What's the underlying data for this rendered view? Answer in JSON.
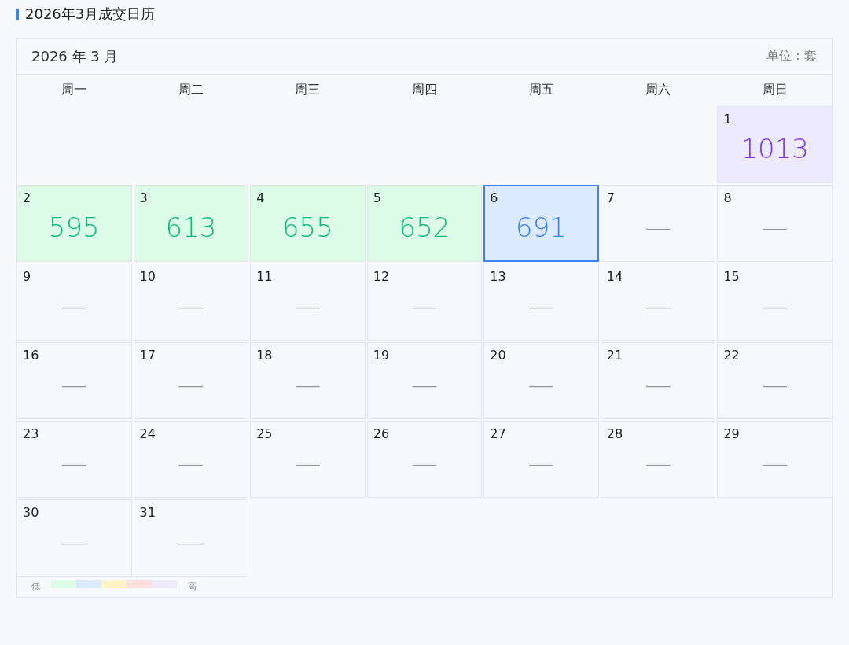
{
  "title": "2026年3月成交日历",
  "calendar": {
    "month_label": "2026 年 3 月",
    "unit": "单位：套",
    "weekdays": [
      "周一",
      "周二",
      "周三",
      "周四",
      "周五",
      "周六",
      "周日"
    ],
    "days": [
      {
        "day": "1",
        "value": "1013",
        "color": "#ede9fe",
        "selected": false
      },
      {
        "day": "2",
        "value": "595",
        "color": "#dcfce7",
        "selected": false
      },
      {
        "day": "3",
        "value": "613",
        "color": "#dcfce7",
        "selected": false
      },
      {
        "day": "4",
        "value": "655",
        "color": "#dcfce7",
        "selected": false
      },
      {
        "day": "5",
        "value": "652",
        "color": "#dcfce7",
        "selected": false
      },
      {
        "day": "6",
        "value": "691",
        "color": "#dbeafe",
        "selected": true
      },
      {
        "day": "7",
        "value": "—",
        "selected": false
      },
      {
        "day": "8",
        "value": "—",
        "selected": false
      },
      {
        "day": "9",
        "value": "—",
        "selected": false
      },
      {
        "day": "10",
        "value": "—",
        "selected": false
      },
      {
        "day": "11",
        "value": "—",
        "selected": false
      },
      {
        "day": "12",
        "value": "—",
        "selected": false
      },
      {
        "day": "13",
        "value": "—",
        "selected": false
      },
      {
        "day": "14",
        "value": "—",
        "selected": false
      },
      {
        "day": "15",
        "value": "—",
        "selected": false
      },
      {
        "day": "16",
        "value": "—",
        "selected": false
      },
      {
        "day": "17",
        "value": "—",
        "selected": false
      },
      {
        "day": "18",
        "value": "—",
        "selected": false
      },
      {
        "day": "19",
        "value": "—",
        "selected": false
      },
      {
        "day": "20",
        "value": "—",
        "selected": false
      },
      {
        "day": "21",
        "value": "—",
        "selected": false
      },
      {
        "day": "22",
        "value": "—",
        "selected": false
      },
      {
        "day": "23",
        "value": "—",
        "selected": false
      },
      {
        "day": "24",
        "value": "—",
        "selected": false
      },
      {
        "day": "25",
        "value": "—",
        "selected": false
      },
      {
        "day": "26",
        "value": "—",
        "selected": false
      },
      {
        "day": "27",
        "value": "—",
        "selected": false
      },
      {
        "day": "28",
        "value": "—",
        "selected": false
      },
      {
        "day": "29",
        "value": "—",
        "selected": false
      },
      {
        "day": "30",
        "value": "—",
        "selected": false
      },
      {
        "day": "31",
        "value": "—",
        "selected": false
      }
    ]
  },
  "legend": {
    "low_label": "低",
    "high_label": "高",
    "swatches": [
      {
        "color": "#dcfce7"
      },
      {
        "color": "#dbeafe"
      },
      {
        "color": "#fef3c7"
      },
      {
        "color": "#fee2e2"
      },
      {
        "color": "#ede9fe"
      }
    ]
  }
}
